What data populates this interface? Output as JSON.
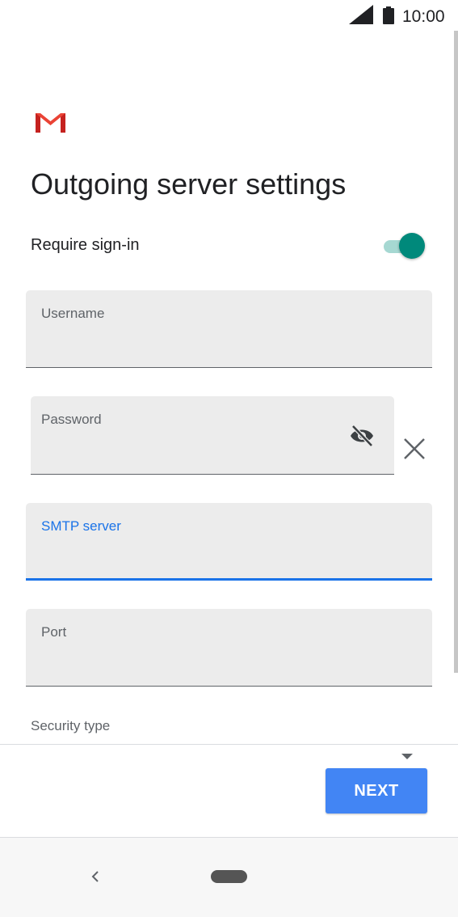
{
  "status_bar": {
    "time": "10:00",
    "icons": [
      "signal-icon",
      "battery-icon"
    ]
  },
  "app": {
    "logo": "gmail-logo",
    "title": "Outgoing server settings"
  },
  "require_signin": {
    "label": "Require sign-in",
    "enabled": true
  },
  "fields": {
    "username": {
      "label": "Username",
      "value": ""
    },
    "password": {
      "label": "Password",
      "value": ""
    },
    "smtp_server": {
      "label": "SMTP server",
      "value": "",
      "focused": true
    },
    "port": {
      "label": "Port",
      "value": ""
    }
  },
  "security": {
    "label": "Security type"
  },
  "buttons": {
    "next": "NEXT"
  },
  "colors": {
    "accent": "#1a73e8",
    "toggle_on": "#00897b",
    "toggle_track": "#a6d8d2",
    "button": "#4285f4",
    "field_bg": "#ececec"
  },
  "nav": {
    "icons": [
      "back-icon",
      "home-icon"
    ]
  }
}
